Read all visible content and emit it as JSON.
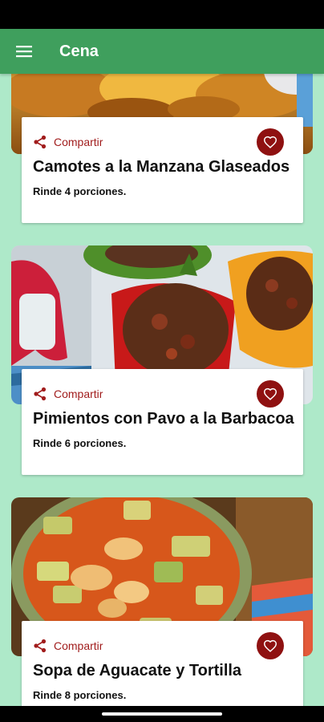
{
  "app_bar": {
    "title": "Cena",
    "menu_icon": "hamburger-menu-icon",
    "background": "#3f9f5d"
  },
  "recipes": [
    {
      "share_label": "Compartir",
      "name": "Camotes a la Manzana Glaseados",
      "servings": "Rinde 4 porciones.",
      "image": "glazed sweet potatoes with apple"
    },
    {
      "share_label": "Compartir",
      "name": "Pimientos con Pavo a la Barbacoa",
      "servings": "Rinde 6 porciones.",
      "image": "bell peppers stuffed with barbecue turkey"
    },
    {
      "share_label": "Compartir",
      "name": "Sopa de Aguacate y Tortilla",
      "servings": "Rinde 8 porciones.",
      "image": "avocado tortilla soup"
    }
  ],
  "icons": {
    "share": "share-icon",
    "favorite": "heart-icon"
  },
  "colors": {
    "background": "#aee9c9",
    "accent": "#a11d1d",
    "favorite_button": "#8f1111"
  }
}
